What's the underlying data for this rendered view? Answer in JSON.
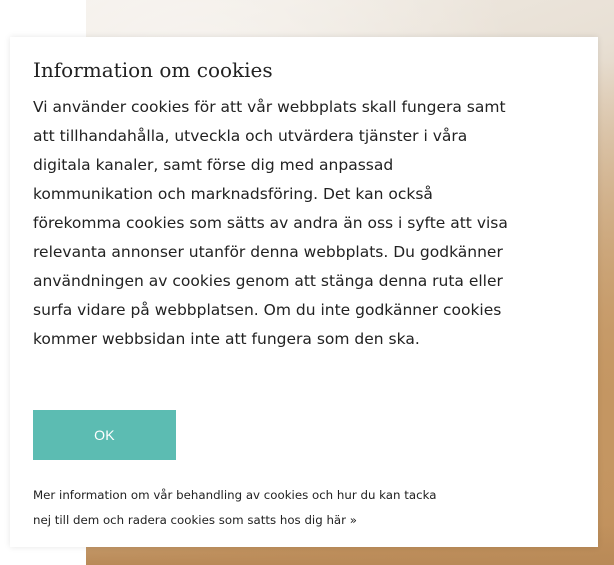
{
  "cookie_dialog": {
    "title": "Information om cookies",
    "body_lines": [
      "Vi använder cookies för att vår webbplats skall fungera samt",
      "att tillhandahålla, utveckla och utvärdera tjänster i våra",
      "digitala kanaler, samt förse dig med anpassad",
      "kommunikation och marknadsföring. Det kan också",
      "förekomma cookies som sätts av andra än oss i syfte att visa",
      "relevanta annonser utanför denna webbplats. Du godkänner",
      "användningen av cookies genom att stänga denna ruta eller",
      "surfa vidare på webbplatsen. Om du inte godkänner cookies",
      "kommer webbsidan inte att fungera som den ska."
    ],
    "ok_label": "OK",
    "more_info_line1": "Mer information om vår behandling av cookies och hur du kan tacka",
    "more_info_line2": "nej till dem och radera cookies som satts hos dig här »"
  },
  "colors": {
    "ok_button": "#5cbcb2",
    "text": "#222222",
    "dialog_background": "#ffffff"
  }
}
